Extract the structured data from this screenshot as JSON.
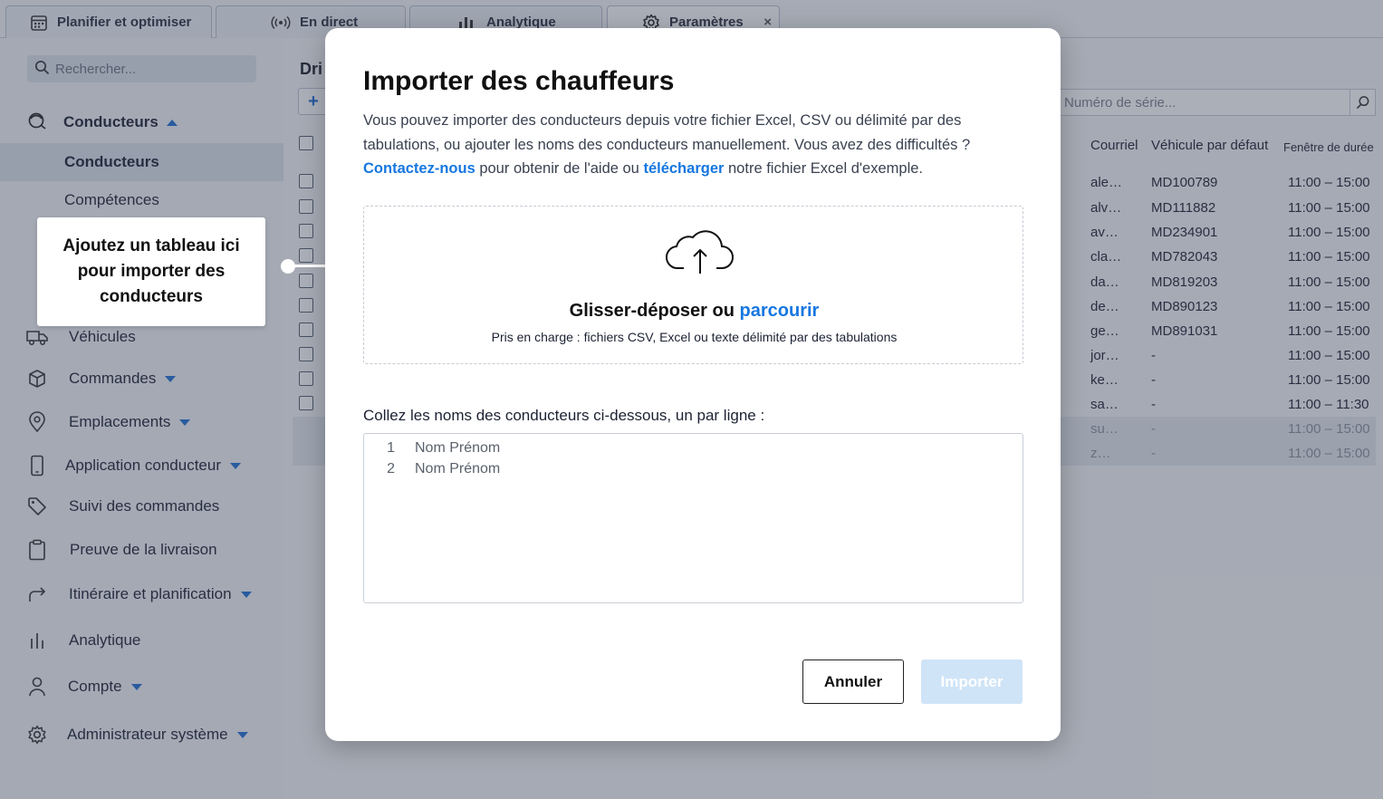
{
  "tabs": [
    {
      "label": "Planifier et optimiser",
      "icon": "calendar-icon"
    },
    {
      "label": "En direct",
      "icon": "broadcast-icon"
    },
    {
      "label": "Analytique",
      "icon": "bar-chart-icon"
    },
    {
      "label": "Paramètres",
      "icon": "gear-icon",
      "close": "×"
    }
  ],
  "sidebar": {
    "search_placeholder": "Rechercher...",
    "section": "Conducteurs",
    "sub_items": [
      "Conducteurs",
      "Compétences"
    ],
    "items": [
      {
        "label": "Véhicules",
        "icon": "truck-icon"
      },
      {
        "label": "Commandes",
        "icon": "box-icon"
      },
      {
        "label": "Emplacements",
        "icon": "location-pin-icon"
      },
      {
        "label": "Application conducteur",
        "icon": "phone-icon"
      },
      {
        "label": "Suivi des commandes",
        "icon": "tag-icon"
      },
      {
        "label": "Preuve de la livraison",
        "icon": "clipboard-icon"
      },
      {
        "label": "Itinéraire et planification",
        "icon": "route-arrow-icon"
      },
      {
        "label": "Analytique",
        "icon": "bar-chart-icon"
      },
      {
        "label": "Compte",
        "icon": "user-icon"
      },
      {
        "label": "Administrateur système",
        "icon": "gear-icon"
      }
    ]
  },
  "main": {
    "title": "Dri",
    "add_label": "+",
    "serial_placeholder": "Numéro de série...",
    "columns": [
      "Courriel",
      "Véhicule par défaut",
      "Fenêtre de durée"
    ],
    "rows": [
      {
        "email": "ale…",
        "vehicle": "MD100789",
        "window": "11:00 – 15:00"
      },
      {
        "email": "alv…",
        "vehicle": "MD111882",
        "window": "11:00 – 15:00"
      },
      {
        "email": "av…",
        "vehicle": "MD234901",
        "window": "11:00 – 15:00"
      },
      {
        "email": "cla…",
        "vehicle": "MD782043",
        "window": "11:00 – 15:00"
      },
      {
        "email": "da…",
        "vehicle": "MD819203",
        "window": "11:00 – 15:00"
      },
      {
        "email": "de…",
        "vehicle": "MD890123",
        "window": "11:00 – 15:00"
      },
      {
        "email": "ge…",
        "vehicle": "MD891031",
        "window": "11:00 – 15:00"
      },
      {
        "email": "jor…",
        "vehicle": "-",
        "window": "11:00 – 15:00"
      },
      {
        "email": "ke…",
        "vehicle": "-",
        "window": "11:00 – 15:00"
      },
      {
        "email": "sa…",
        "vehicle": "-",
        "window": "11:00 – 11:30"
      },
      {
        "email": "su…",
        "vehicle": "-",
        "window": "11:00 – 15:00"
      },
      {
        "email": "z…",
        "vehicle": "-",
        "window": "11:00 – 15:00"
      }
    ]
  },
  "callout": {
    "text": "Ajoutez un tableau ici pour importer des conducteurs"
  },
  "modal": {
    "title": "Importer des chauffeurs",
    "desc_1": "Vous pouvez importer des conducteurs depuis votre fichier Excel, CSV ou délimité par des tabulations, ou ajouter les noms des conducteurs manuellement. Vous avez des difficultés ?",
    "contact_link": "Contactez-nous",
    "desc_2": " pour obtenir de l'aide ou ",
    "download_link": "télécharger",
    "desc_3": " notre fichier Excel d'exemple.",
    "drop_title": "Glisser-déposer ou ",
    "browse_link": "parcourir",
    "drop_sub": "Pris en charge : fichiers CSV, Excel ou texte délimité par des tabulations",
    "paste_label": "Collez les noms des conducteurs ci-dessous, un par ligne :",
    "lines": [
      {
        "n": "1",
        "text": "Nom Prénom"
      },
      {
        "n": "2",
        "text": "Nom Prénom"
      }
    ],
    "cancel": "Annuler",
    "import": "Importer"
  },
  "colors": {
    "accent": "#1677e0",
    "import_disabled": "#cfe4f7"
  }
}
